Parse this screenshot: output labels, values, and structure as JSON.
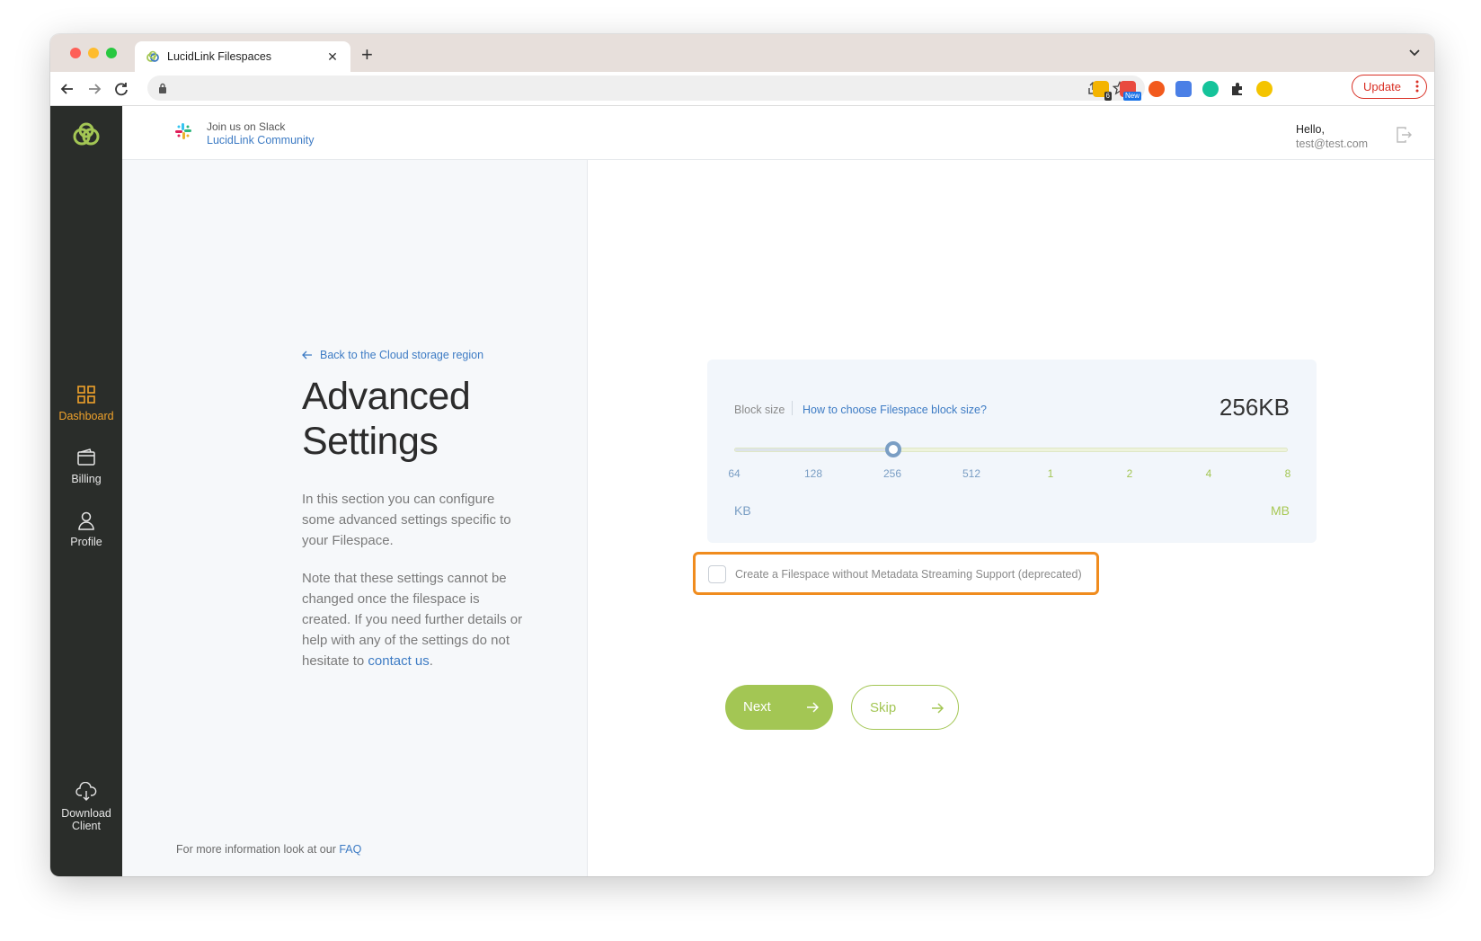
{
  "browser": {
    "tab_title": "LucidLink Filespaces",
    "address": "",
    "update_label": "Update",
    "extensions": [
      {
        "name": "sticky-notes-extension",
        "badge": "6"
      },
      {
        "name": "new-extension",
        "badge": "New"
      },
      {
        "name": "brave-extension"
      },
      {
        "name": "translate-extension"
      },
      {
        "name": "grammarly-extension"
      },
      {
        "name": "puzzle-extension"
      },
      {
        "name": "profile-avatar"
      }
    ]
  },
  "sidebar": {
    "items": [
      {
        "label": "Dashboard",
        "icon": "grid-icon",
        "active": true
      },
      {
        "label": "Billing",
        "icon": "wallet-icon"
      },
      {
        "label": "Profile",
        "icon": "user-icon"
      },
      {
        "label": "Download Client",
        "icon": "cloud-download-icon"
      }
    ]
  },
  "header": {
    "slack_line1": "Join us on Slack",
    "slack_line2": "LucidLink Community",
    "hello": "Hello,",
    "email": "test@test.com"
  },
  "left": {
    "back_link": "Back to the Cloud storage region",
    "title_line1": "Advanced",
    "title_line2": "Settings",
    "desc1": "In this section you can configure some advanced  settings specific to your Filespace.",
    "desc2_prefix": "Note that these settings  cannot be changed once the filespace is created. If you need further  details or help with any of the settings do not hesitate to ",
    "desc2_link": "contact us",
    "desc2_suffix": ".",
    "faq_prefix": "For more information look at our ",
    "faq_link": "FAQ"
  },
  "block_size": {
    "label": "Block size",
    "help_link": "How to choose Filespace block size?",
    "value": "256KB",
    "selected_index": 2,
    "ticks": [
      "64",
      "128",
      "256",
      "512",
      "1",
      "2",
      "4",
      "8"
    ],
    "unit_kb": "KB",
    "unit_mb": "MB"
  },
  "metadata_option": {
    "label": "Create a Filespace without Metadata Streaming Support (deprecated)",
    "checked": false
  },
  "actions": {
    "next_label": "Next",
    "skip_label": "Skip"
  },
  "colors": {
    "accent_green": "#a3c654",
    "sidebar_bg": "#2a2d2a",
    "active_orange": "#f0a22b",
    "link_blue": "#3d7bc4",
    "highlight_orange": "#f08c1e"
  }
}
